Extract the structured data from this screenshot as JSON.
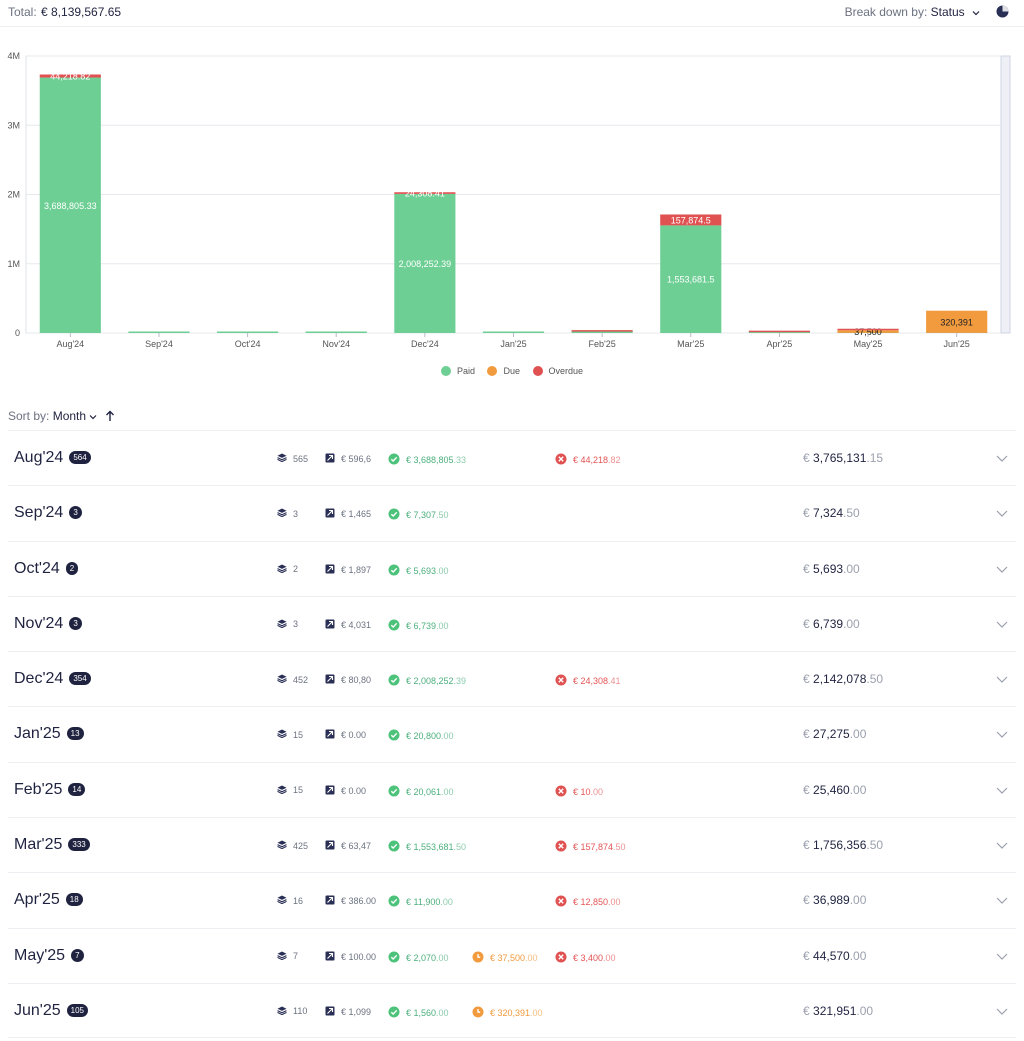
{
  "header": {
    "total_label": "Total:",
    "total_value": "€ 8,139,567.65",
    "breakdown_label": "Break down by:",
    "breakdown_value": "Status"
  },
  "colors": {
    "paid": "#6ecf95",
    "due": "#f19a3e",
    "overdue": "#e05252"
  },
  "chart_data": {
    "type": "bar",
    "stacked": true,
    "categories": [
      "Aug'24",
      "Sep'24",
      "Oct'24",
      "Nov'24",
      "Dec'24",
      "Jan'25",
      "Feb'25",
      "Mar'25",
      "Apr'25",
      "May'25",
      "Jun'25"
    ],
    "series": [
      {
        "name": "Paid",
        "values": [
          3688805.33,
          7307.5,
          5693,
          6739,
          2008252.39,
          20800,
          20061,
          1553681.5,
          11900,
          2070,
          1560
        ]
      },
      {
        "name": "Due",
        "values": [
          0,
          0,
          0,
          0,
          0,
          0,
          0,
          0,
          0,
          37500,
          320391
        ]
      },
      {
        "name": "Overdue",
        "values": [
          44218.82,
          0,
          0,
          0,
          24308.41,
          0,
          10,
          157874.5,
          12850,
          3400,
          0
        ]
      }
    ],
    "data_labels": {
      "Paid": [
        "3,688,805.33",
        "",
        "",
        "",
        "2,008,252.39",
        "",
        "",
        "1,553,681.5",
        "",
        "",
        ""
      ],
      "Due": [
        "",
        "",
        "",
        "",
        "",
        "",
        "",
        "",
        "",
        "37,500",
        "320,391"
      ],
      "Overdue": [
        "44,218.82",
        "",
        "",
        "",
        "24,308.41",
        "",
        "",
        "157,874.5",
        "",
        "",
        ""
      ]
    },
    "y_ticks": [
      "0",
      "1M",
      "2M",
      "3M",
      "4M"
    ],
    "ylim": [
      0,
      4000000
    ],
    "legend": [
      "Paid",
      "Due",
      "Overdue"
    ],
    "legend_position": "bottom",
    "grid": true
  },
  "sort": {
    "label": "Sort by:",
    "value": "Month"
  },
  "rows": [
    {
      "month": "Aug'24",
      "badge": "564",
      "count": "565",
      "inv": "€ 596,6",
      "paid": "€ 3,688,805",
      "paid_c": ".33",
      "due": "",
      "due_c": "",
      "over": "€ 44,218",
      "over_c": ".82",
      "total_w": "3,765,131",
      "total_c": ".15"
    },
    {
      "month": "Sep'24",
      "badge": "3",
      "count": "3",
      "inv": "€ 1,465",
      "paid": "€ 7,307",
      "paid_c": ".50",
      "due": "",
      "due_c": "",
      "over": "",
      "over_c": "",
      "total_w": "7,324",
      "total_c": ".50"
    },
    {
      "month": "Oct'24",
      "badge": "2",
      "count": "2",
      "inv": "€ 1,897",
      "paid": "€ 5,693",
      "paid_c": ".00",
      "due": "",
      "due_c": "",
      "over": "",
      "over_c": "",
      "total_w": "5,693",
      "total_c": ".00"
    },
    {
      "month": "Nov'24",
      "badge": "3",
      "count": "3",
      "inv": "€ 4,031",
      "paid": "€ 6,739",
      "paid_c": ".00",
      "due": "",
      "due_c": "",
      "over": "",
      "over_c": "",
      "total_w": "6,739",
      "total_c": ".00"
    },
    {
      "month": "Dec'24",
      "badge": "354",
      "count": "452",
      "inv": "€ 80,80",
      "paid": "€ 2,008,252",
      "paid_c": ".39",
      "due": "",
      "due_c": "",
      "over": "€ 24,308",
      "over_c": ".41",
      "total_w": "2,142,078",
      "total_c": ".50"
    },
    {
      "month": "Jan'25",
      "badge": "13",
      "count": "15",
      "inv": "€ 0.00",
      "paid": "€ 20,800",
      "paid_c": ".00",
      "due": "",
      "due_c": "",
      "over": "",
      "over_c": "",
      "total_w": "27,275",
      "total_c": ".00"
    },
    {
      "month": "Feb'25",
      "badge": "14",
      "count": "15",
      "inv": "€ 0.00",
      "paid": "€ 20,061",
      "paid_c": ".00",
      "due": "",
      "due_c": "",
      "over": "€ 10",
      "over_c": ".00",
      "total_w": "25,460",
      "total_c": ".00"
    },
    {
      "month": "Mar'25",
      "badge": "333",
      "count": "425",
      "inv": "€ 63,47",
      "paid": "€ 1,553,681",
      "paid_c": ".50",
      "due": "",
      "due_c": "",
      "over": "€ 157,874",
      "over_c": ".50",
      "total_w": "1,756,356",
      "total_c": ".50"
    },
    {
      "month": "Apr'25",
      "badge": "18",
      "count": "16",
      "inv": "€ 386.00",
      "paid": "€ 11,900",
      "paid_c": ".00",
      "due": "",
      "due_c": "",
      "over": "€ 12,850",
      "over_c": ".00",
      "total_w": "36,989",
      "total_c": ".00"
    },
    {
      "month": "May'25",
      "badge": "7",
      "count": "7",
      "inv": "€ 100.00",
      "paid": "€ 2,070",
      "paid_c": ".00",
      "due": "€ 37,500",
      "due_c": ".00",
      "over": "€ 3,400",
      "over_c": ".00",
      "total_w": "44,570",
      "total_c": ".00"
    },
    {
      "month": "Jun'25",
      "badge": "105",
      "count": "110",
      "inv": "€ 1,099",
      "paid": "€ 1,560",
      "paid_c": ".00",
      "due": "€ 320,391",
      "due_c": ".00",
      "over": "",
      "over_c": "",
      "total_w": "321,951",
      "total_c": ".00"
    }
  ]
}
